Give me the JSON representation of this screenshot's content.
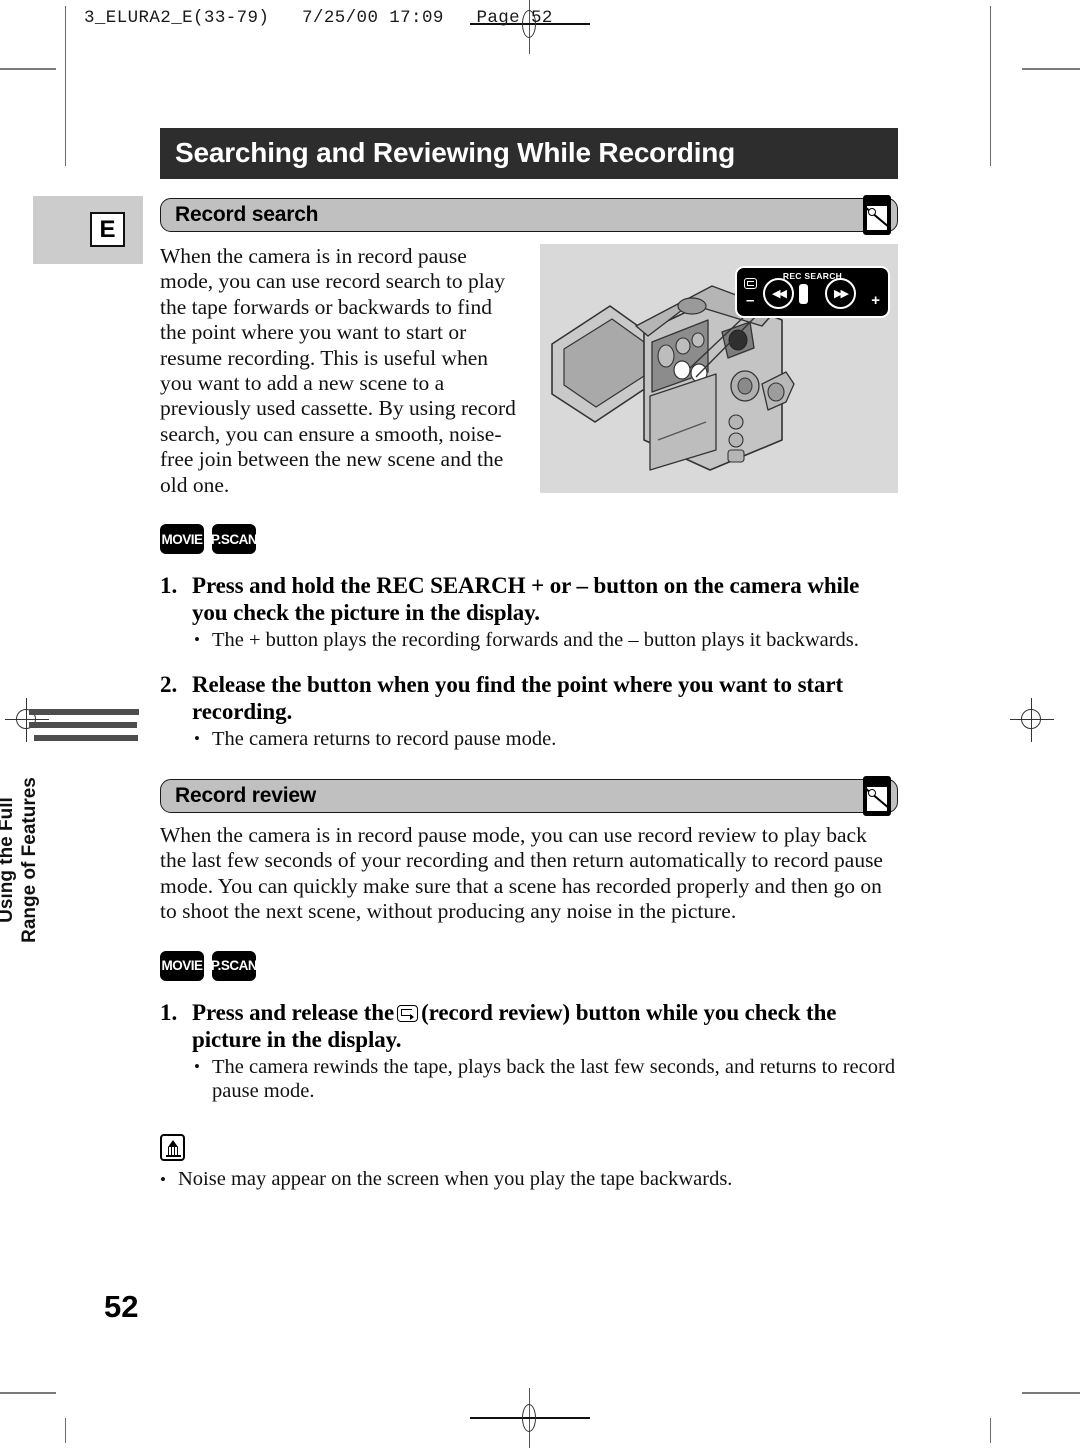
{
  "print_slug": "3_ELURA2_E(33-79)   7/25/00 17:09   Page 52",
  "language_tab": "E",
  "side_chapter_title": "Using the Full\nRange of Features",
  "page_title": "Searching and Reviewing While Recording",
  "page_number": "52",
  "sections": [
    {
      "heading": "Record search",
      "icon": "camcorder-tape-icon",
      "intro": "When the camera is in record pause mode, you can use record search to play the tape forwards or backwards to find the point where you want to start or resume recording. This is useful when you want to add a new scene to a previously used cassette. By using record search, you can ensure a smooth, noise-free join between the new scene and the old one.",
      "badges": [
        "MOVIE",
        "P.SCAN"
      ],
      "steps": [
        {
          "number": "1.",
          "heading": "Press and hold the REC SEARCH + or – button on the camera while you check the picture in the display.",
          "bullets": [
            "The + button plays the recording forwards and the – button plays it backwards."
          ]
        },
        {
          "number": "2.",
          "heading": "Release the button when you find the point where you want to start recording.",
          "bullets": [
            "The camera returns to record pause mode."
          ]
        }
      ]
    },
    {
      "heading": "Record review",
      "icon": "camcorder-tape-icon",
      "intro": "When the camera is in record pause mode, you can use record review to play back the last few seconds of your recording and then return automatically to record pause mode. You can quickly make sure that a scene has recorded properly and then go on to shoot the next scene, without producing any noise in the picture.",
      "badges": [
        "MOVIE",
        "P.SCAN"
      ],
      "steps": [
        {
          "number": "1.",
          "heading_before_icon": "Press and release the",
          "heading_after_icon": "(record review) button while you check the picture in the display.",
          "bullets": [
            "The camera rewinds the tape, plays back the last few seconds, and returns to record pause mode."
          ]
        }
      ]
    }
  ],
  "note": {
    "icon": "note-pencil-icon",
    "bullet": "Noise may appear on the screen when you play the tape backwards."
  },
  "figure": {
    "alt": "camcorder-illustration",
    "callout": {
      "caption": "REC SEARCH",
      "minus": "–",
      "plus": "+",
      "rewind_glyph": "◀◀",
      "forward_glyph": "▶▶",
      "record_review_icon": "record-review-icon"
    }
  },
  "colors": {
    "title_bar_bg": "#2d2d2d",
    "section_head_bg": "#c0c0c0",
    "figure_bg": "#d9d9d9",
    "tab_block_bg": "#cccccc",
    "side_bar": "#4d4d4d"
  }
}
